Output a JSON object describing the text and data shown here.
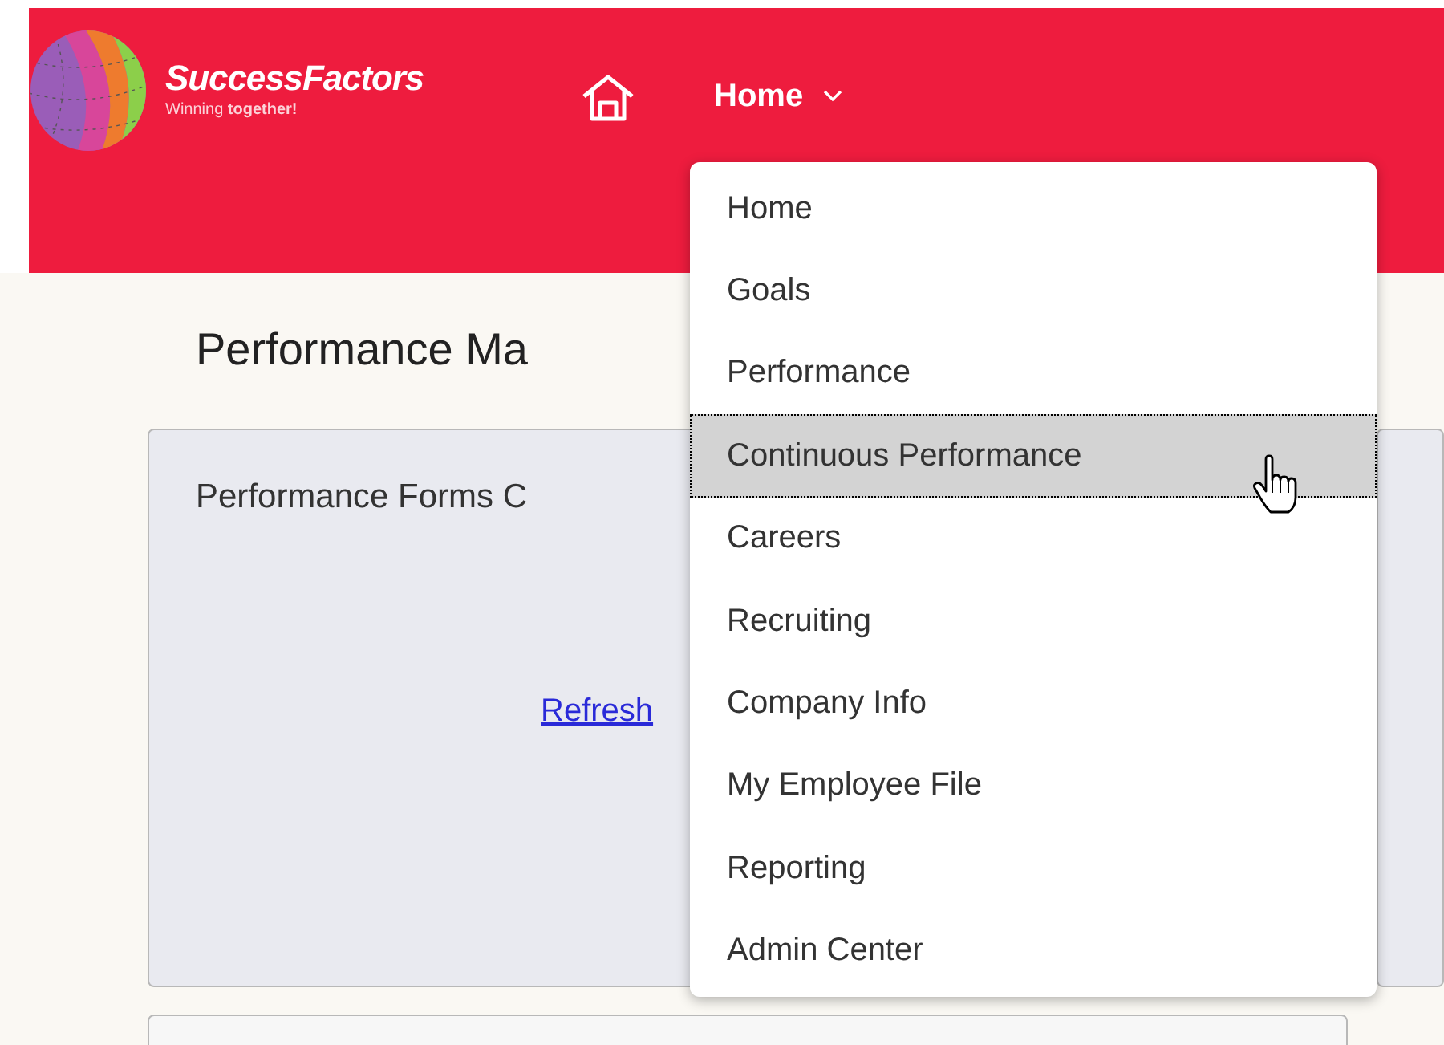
{
  "header": {
    "brand": "SuccessFactors",
    "tagline": "Winning **together!**",
    "nav_label": "Home"
  },
  "page": {
    "title": "Performance Ma",
    "cards": [
      {
        "title": "Performance Forms C",
        "link": "Refresh"
      }
    ]
  },
  "menu": {
    "items": [
      {
        "label": "Home",
        "selected": false
      },
      {
        "label": "Goals",
        "selected": false
      },
      {
        "label": "Performance",
        "selected": false
      },
      {
        "label": "Continuous Performance",
        "selected": true
      },
      {
        "label": "Careers",
        "selected": false
      },
      {
        "label": "Recruiting",
        "selected": false
      },
      {
        "label": "Company Info",
        "selected": false
      },
      {
        "label": "My Employee File",
        "selected": false
      },
      {
        "label": "Reporting",
        "selected": false
      },
      {
        "label": "Admin Center",
        "selected": false
      }
    ]
  }
}
